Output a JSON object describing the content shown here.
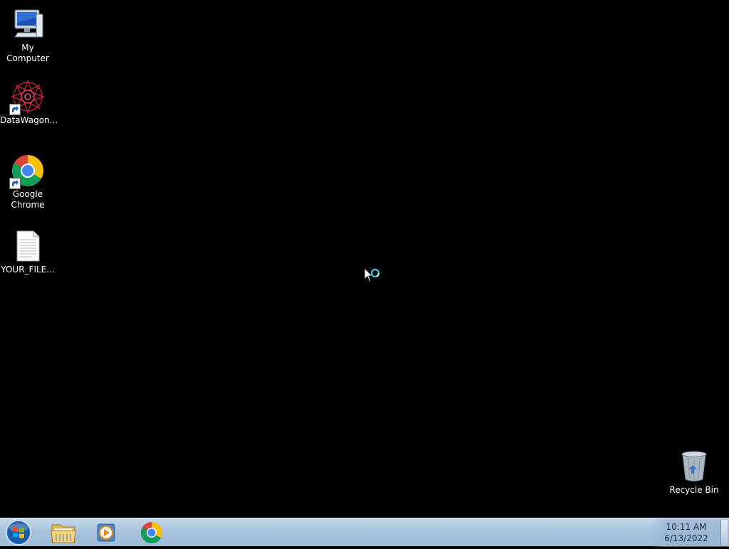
{
  "desktop": {
    "background_color": "#000000",
    "icons": [
      {
        "label": "My Computer",
        "icon": "computer-icon"
      },
      {
        "label": "DataWagon...",
        "icon": "datawagon-icon",
        "shortcut": true
      },
      {
        "label": "Google\nChrome",
        "icon": "chrome-icon",
        "shortcut": true
      },
      {
        "label": "YOUR_FILE...",
        "icon": "text-file-icon"
      },
      {
        "label": "Recycle Bin",
        "icon": "recycle-bin-icon"
      }
    ]
  },
  "taskbar": {
    "pinned": [
      {
        "name": "Windows Explorer",
        "icon": "folder-icon"
      },
      {
        "name": "Windows Media Player",
        "icon": "media-player-icon"
      },
      {
        "name": "Google Chrome",
        "icon": "chrome-icon"
      }
    ],
    "clock": {
      "time": "10:11 AM",
      "date": "6/13/2022"
    }
  },
  "colors": {
    "taskbar": "#a9c3dd",
    "cursor_busy": "#41c8d8"
  }
}
